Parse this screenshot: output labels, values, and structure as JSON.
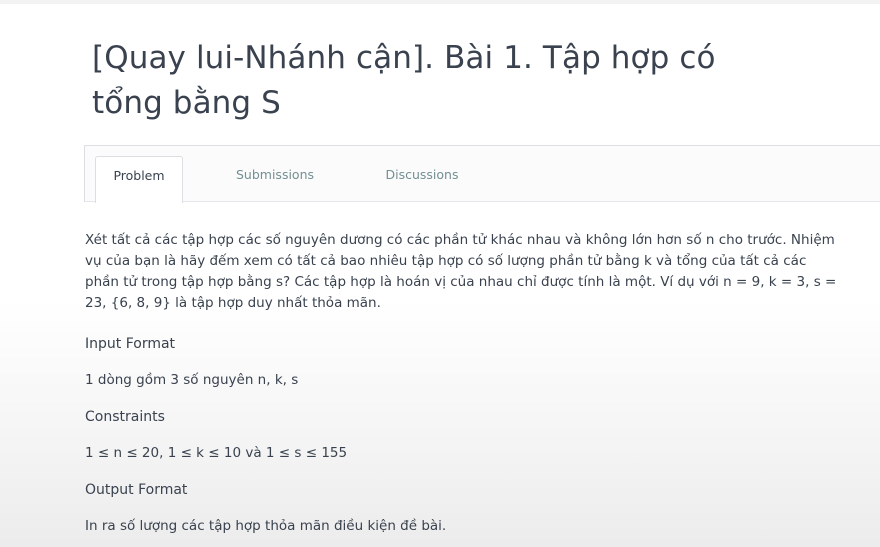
{
  "problem": {
    "title": "[Quay lui-Nhánh cận]. Bài 1. Tập hợp có tổng bằng S"
  },
  "tabs": [
    {
      "label": "Problem",
      "active": true
    },
    {
      "label": "Submissions",
      "active": false
    },
    {
      "label": "Discussions",
      "active": false
    }
  ],
  "statement": {
    "intro": "Xét tất cả các tập hợp các số nguyên dương có các phần tử khác nhau và không lớn hơn số n cho trước. Nhiệm vụ của bạn là hãy đếm xem có tất cả bao nhiêu tập hợp có số lượng phần tử bằng k và tổng của tất cả các phần tử trong tập hợp bằng s? Các tập hợp là hoán vị của nhau chỉ được tính là một. Ví dụ với n = 9, k = 3, s = 23, {6, 8, 9} là tập hợp duy nhất thỏa mãn.",
    "input_heading": "Input Format",
    "input_text": "1 dòng gồm 3 số nguyên n, k, s",
    "constraints_heading": "Constraints",
    "constraints_text": "1 ≤ n ≤ 20, 1 ≤ k ≤ 10 và 1 ≤ s ≤ 155",
    "output_heading": "Output Format",
    "output_text": "In ra số lượng các tập hợp thỏa mãn điều kiện đề bài."
  }
}
